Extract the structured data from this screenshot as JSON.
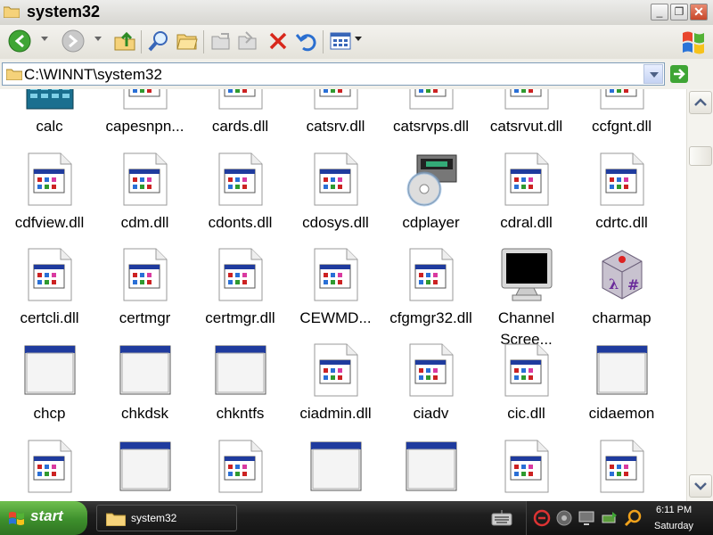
{
  "window": {
    "title": "system32",
    "btn_min": "_",
    "btn_max": "❐",
    "btn_close": "✕"
  },
  "toolbar": {
    "buttons": [
      "back-icon",
      "forward-icon",
      "up-folder-icon",
      "search-icon",
      "folders-icon",
      "copy-to-icon",
      "move-to-icon",
      "delete-icon",
      "undo-icon",
      "views-icon"
    ]
  },
  "address": {
    "path": "C:\\WINNT\\system32"
  },
  "files": [
    {
      "name": "calc",
      "icon": "calculator-icon"
    },
    {
      "name": "capesnpn...",
      "icon": "dll-file-icon"
    },
    {
      "name": "cards.dll",
      "icon": "dll-file-icon"
    },
    {
      "name": "catsrv.dll",
      "icon": "dll-file-icon"
    },
    {
      "name": "catsrvps.dll",
      "icon": "dll-file-icon"
    },
    {
      "name": "catsrvut.dll",
      "icon": "dll-file-icon"
    },
    {
      "name": "ccfgnt.dll",
      "icon": "dll-file-icon"
    },
    {
      "name": "cdfview.dll",
      "icon": "dll-file-icon"
    },
    {
      "name": "cdm.dll",
      "icon": "dll-file-icon"
    },
    {
      "name": "cdonts.dll",
      "icon": "dll-file-icon"
    },
    {
      "name": "cdosys.dll",
      "icon": "dll-file-icon"
    },
    {
      "name": "cdplayer",
      "icon": "cd-player-icon"
    },
    {
      "name": "cdral.dll",
      "icon": "dll-file-icon"
    },
    {
      "name": "cdrtc.dll",
      "icon": "dll-file-icon"
    },
    {
      "name": "certcli.dll",
      "icon": "dll-file-icon"
    },
    {
      "name": "certmgr",
      "icon": "dll-file-icon"
    },
    {
      "name": "certmgr.dll",
      "icon": "dll-file-icon"
    },
    {
      "name": "CEWMD...",
      "icon": "dll-file-icon"
    },
    {
      "name": "cfgmgr32.dll",
      "icon": "dll-file-icon"
    },
    {
      "name": "Channel Scree...",
      "icon": "monitor-icon"
    },
    {
      "name": "charmap",
      "icon": "charmap-icon"
    },
    {
      "name": "chcp",
      "icon": "console-window-icon"
    },
    {
      "name": "chkdsk",
      "icon": "console-window-icon"
    },
    {
      "name": "chkntfs",
      "icon": "console-window-icon"
    },
    {
      "name": "ciadmin.dll",
      "icon": "dll-file-icon"
    },
    {
      "name": "ciadv",
      "icon": "dll-file-icon"
    },
    {
      "name": "cic.dll",
      "icon": "dll-file-icon"
    },
    {
      "name": "cidaemon",
      "icon": "console-window-icon"
    },
    {
      "name": "",
      "icon": "dll-file-icon"
    },
    {
      "name": "",
      "icon": "console-window-icon"
    },
    {
      "name": "",
      "icon": "dll-file-icon"
    },
    {
      "name": "",
      "icon": "console-window-icon"
    },
    {
      "name": "",
      "icon": "console-window-icon"
    },
    {
      "name": "",
      "icon": "dll-file-icon"
    },
    {
      "name": "",
      "icon": "dll-file-icon"
    }
  ],
  "taskbar": {
    "start_label": "start",
    "task_label": "system32",
    "clock_time": "6:11 PM",
    "clock_day": "Saturday"
  }
}
